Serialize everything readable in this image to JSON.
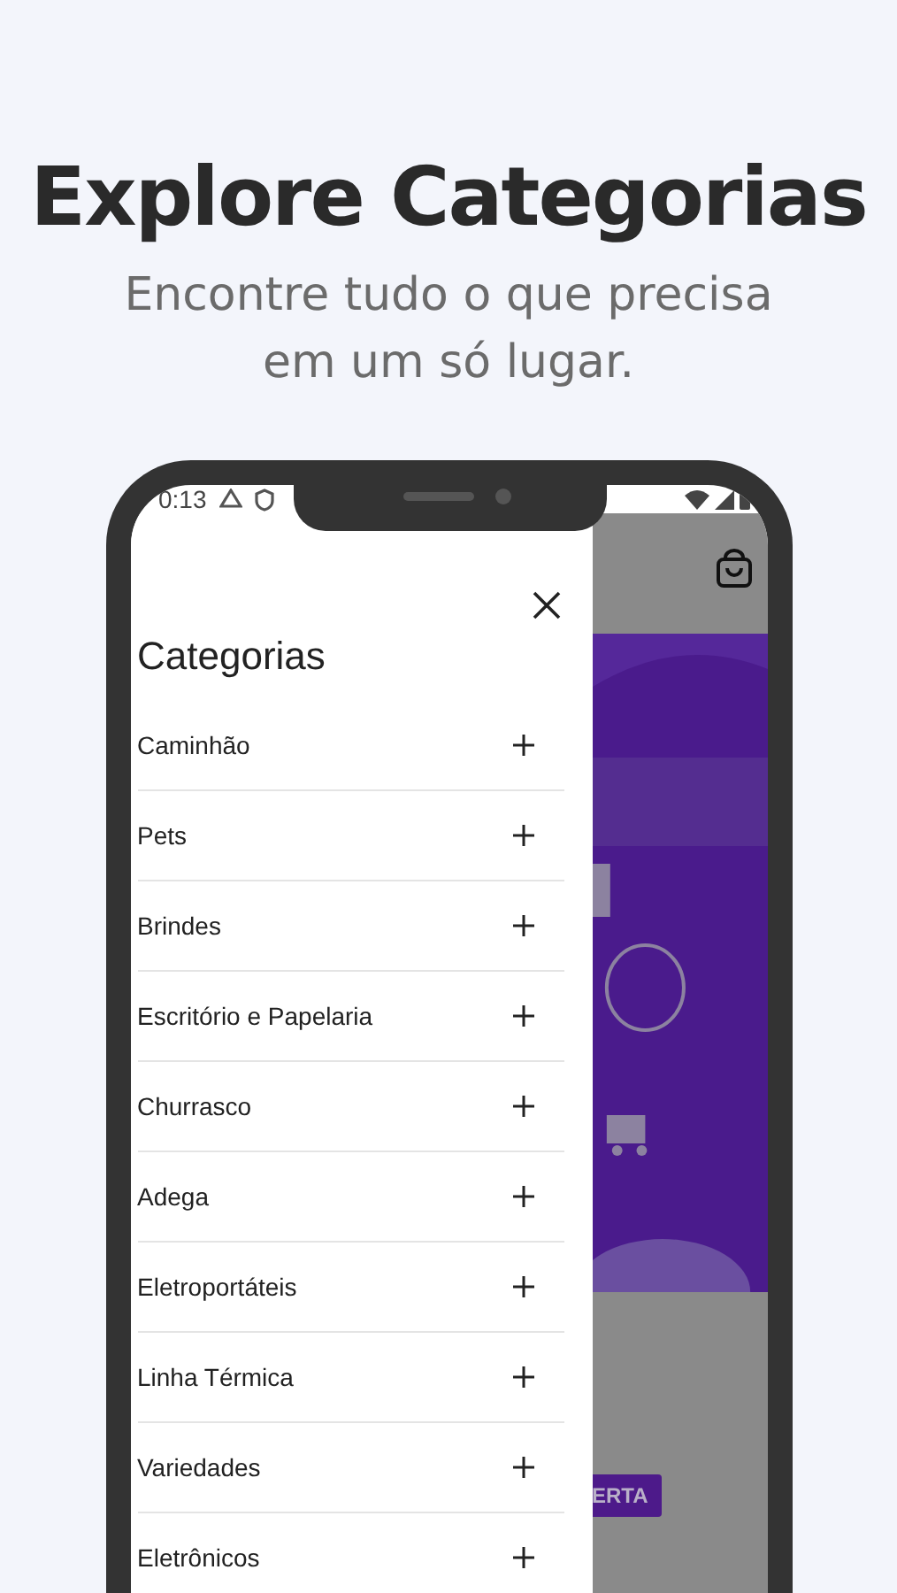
{
  "headline": {
    "title": "Explore Categorias",
    "subtitle": "Encontre tudo o que precisa em um só lugar."
  },
  "status_bar": {
    "time": "0:13"
  },
  "drawer": {
    "title": "Categorias",
    "items": [
      {
        "label": "Caminhão",
        "expanded": false
      },
      {
        "label": "Pets",
        "expanded": false
      },
      {
        "label": "Brindes",
        "expanded": false
      },
      {
        "label": "Escritório e Papelaria",
        "expanded": false
      },
      {
        "label": "Churrasco",
        "expanded": false
      },
      {
        "label": "Adega",
        "expanded": false
      },
      {
        "label": "Eletroportáteis",
        "expanded": false
      },
      {
        "label": "Linha Térmica",
        "expanded": false
      },
      {
        "label": "Variedades",
        "expanded": false
      },
      {
        "label": "Eletrônicos",
        "expanded": false
      }
    ]
  },
  "background_page": {
    "button": "ERTA"
  }
}
